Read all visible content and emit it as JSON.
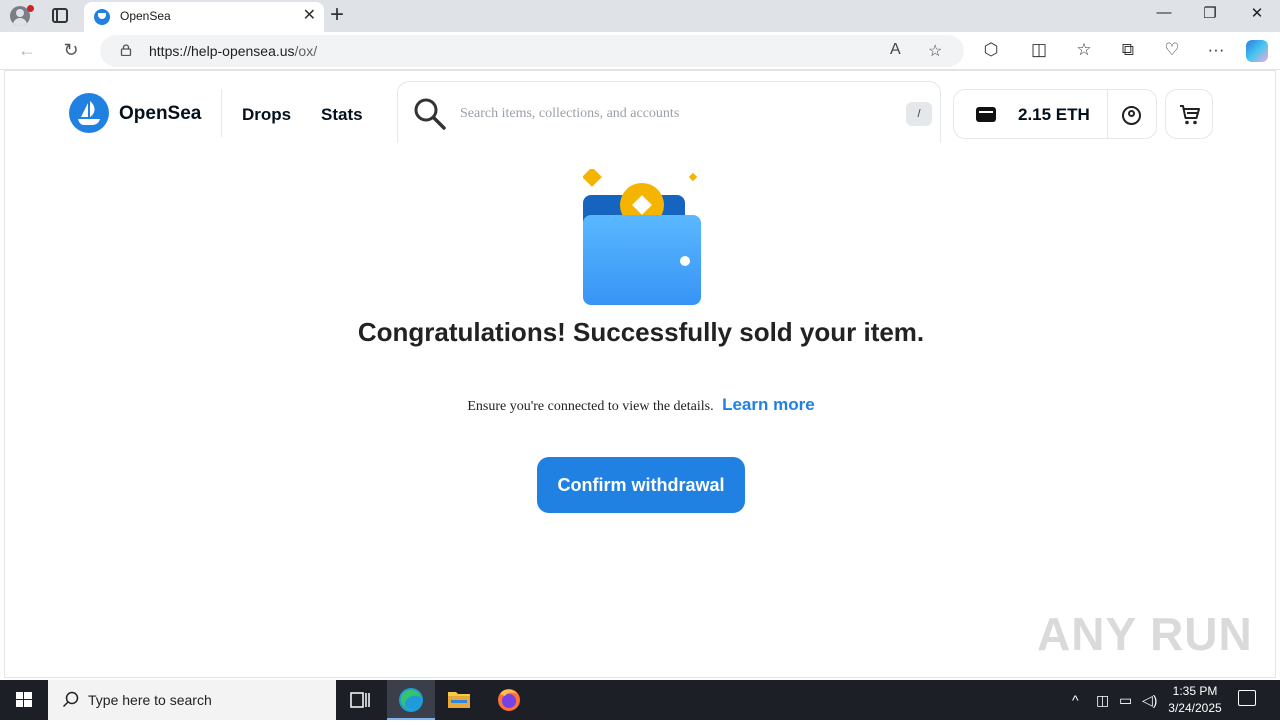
{
  "browser": {
    "tab_title": "OpenSea",
    "url_host": "https://help-opensea.us",
    "url_path": "/ox/"
  },
  "site": {
    "brand": "OpenSea",
    "nav": [
      "Drops",
      "Stats"
    ],
    "search_placeholder": "Search items, collections, and accounts",
    "search_shortcut": "/",
    "balance": "2.15 ETH",
    "accent_color": "#2081e2"
  },
  "main": {
    "headline": "Congratulations! Successfully sold your item.",
    "subtext": "Ensure you're connected to view the details.",
    "learn_more": "Learn more",
    "cta": "Confirm withdrawal",
    "watermark": "ANY RUN"
  },
  "taskbar": {
    "search_placeholder": "Type here to search",
    "time": "1:35 PM",
    "date": "3/24/2025"
  }
}
